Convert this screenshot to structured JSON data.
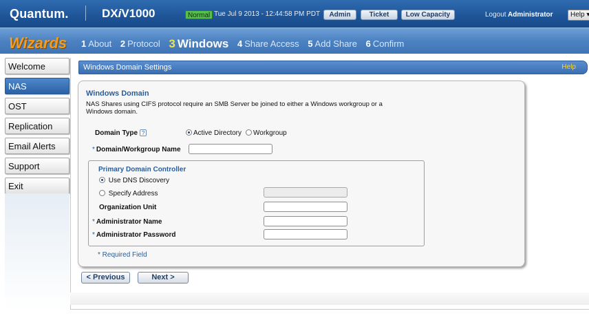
{
  "header": {
    "brand": "Quantum.",
    "product_prefix": "DX",
    "product_italic": "i",
    "product_suffix": "V1000",
    "mode": "Normal",
    "datetime": "Tue Jul 9 2013 - 12:44:58 PM PDT",
    "buttons": {
      "admin": "Admin",
      "ticket": "Ticket",
      "capacity": "Low Capacity"
    },
    "logout": "Logout",
    "user": "Administrator",
    "help": "Help"
  },
  "wizard": {
    "title": "Wizards",
    "steps": [
      {
        "num": "1",
        "label": "About"
      },
      {
        "num": "2",
        "label": "Protocol"
      },
      {
        "num": "3",
        "label": "Windows"
      },
      {
        "num": "4",
        "label": "Share Access"
      },
      {
        "num": "5",
        "label": "Add Share"
      },
      {
        "num": "6",
        "label": "Confirm"
      }
    ],
    "current_step": 3
  },
  "sidebar": {
    "items": [
      {
        "label": "Welcome"
      },
      {
        "label": "NAS",
        "active": true
      },
      {
        "label": "OST"
      },
      {
        "label": "Replication"
      },
      {
        "label": "Email Alerts"
      },
      {
        "label": "Support"
      },
      {
        "label": "Exit"
      }
    ]
  },
  "main": {
    "section_title": "Windows Domain Settings",
    "section_help": "Help",
    "panel": {
      "title": "Windows Domain",
      "description": "NAS Shares using CIFS protocol require an SMB Server be joined to either a Windows workgroup or a Windows domain.",
      "domain_type_label": "Domain Type",
      "help_glyph": "?",
      "domain_type_options": [
        "Active Directory",
        "Workgroup"
      ],
      "domain_type_selected": "Active Directory",
      "required_marker": "*",
      "domain_name_label": "Domain/Workgroup Name",
      "domain_name_value": "",
      "pdc": {
        "title": "Primary Domain Controller",
        "options": [
          "Use DNS Discovery",
          "Specify Address"
        ],
        "selected": "Use DNS Discovery",
        "address_value": "",
        "org_unit_label": "Organization Unit",
        "org_unit_value": "",
        "admin_name_label": "Administrator Name",
        "admin_name_value": "",
        "admin_password_label": "Administrator Password",
        "admin_password_value": ""
      },
      "required_note": "* Required Field"
    },
    "buttons": {
      "previous": "< Previous",
      "next": "Next >"
    }
  },
  "colors": {
    "header_blue": "#1e5598",
    "wizard_orange": "#f29c20",
    "current_step_yellow": "#f3e24a",
    "link_blue": "#2a5d9a",
    "mode_green": "#55c14a"
  }
}
